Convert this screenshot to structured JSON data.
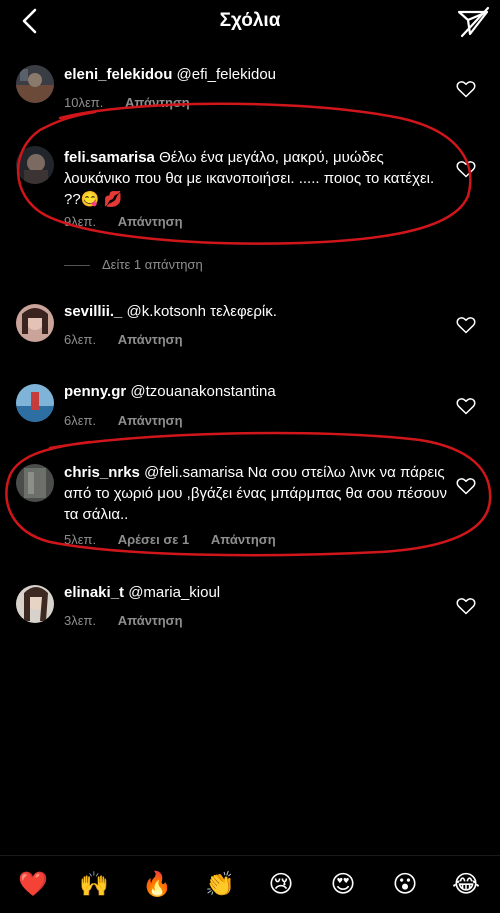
{
  "header": {
    "title": "Σχόλια"
  },
  "comments": [
    {
      "user": "eleni_felekidou",
      "text": "@efi_felekidou",
      "time": "10λεπ.",
      "likes": "",
      "reply": "Απάντηση"
    },
    {
      "user": "feli.samarisa",
      "text": "Θέλω ένα μεγάλο, μακρύ, μυώδες λουκάνικο που θα με ικανοποιήσει. ..... ποιος το κατέχει. ??😋 💋",
      "time": "9λεπ.",
      "likes": "",
      "reply": "Απάντηση"
    },
    {
      "user": "sevillii._",
      "text": "@k.kotsonh τελεφερίκ.",
      "time": "6λεπ.",
      "likes": "",
      "reply": "Απάντηση"
    },
    {
      "user": "penny.gr",
      "text": "@tzouanakonstantina",
      "time": "6λεπ.",
      "likes": "",
      "reply": "Απάντηση"
    },
    {
      "user": "chris_nrks",
      "text": "@feli.samarisa  Να σου στείλω λινκ να πάρεις από το χωριό μου ,βγάζει ένας μπάρμπας θα σου πέσουν τα σάλια..",
      "time": "5λεπ.",
      "likes": "Αρέσει σε 1",
      "reply": "Απάντηση"
    },
    {
      "user": "elinaki_t",
      "text": "@maria_kioul",
      "time": "3λεπ.",
      "likes": "",
      "reply": "Απάντηση"
    }
  ],
  "view_replies": "Δείτε 1 απάντηση",
  "emoji_bar": [
    "❤️",
    "🙌",
    "🔥",
    "👏",
    "😢",
    "😍",
    "😮",
    "😂"
  ],
  "colors": {
    "annotation": "#d0161b",
    "meta_text": "#8e8e8e"
  }
}
